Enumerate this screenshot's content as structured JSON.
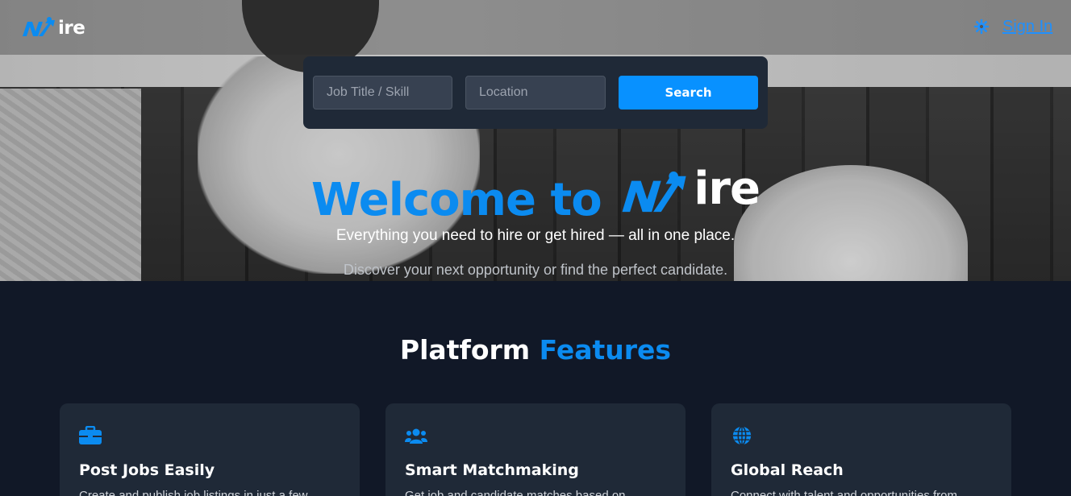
{
  "header": {
    "logo_accent": "NX",
    "logo_rest": "Hire",
    "logo_display_rest": "ire",
    "settings_icon": "gear-icon",
    "signin_label": "Sign In"
  },
  "search": {
    "job_placeholder": "Job Title / Skill",
    "location_placeholder": "Location",
    "button_label": "Search"
  },
  "hero": {
    "welcome_prefix": "Welcome to ",
    "brand_accent": "NX",
    "brand_rest": "ire",
    "tagline": "Everything you need to hire or get hired — all in one place.",
    "subtitle": "Discover your next opportunity or find the perfect candidate."
  },
  "features": {
    "title_main": "Platform ",
    "title_accent": "Features",
    "cards": [
      {
        "icon": "briefcase-icon",
        "title": "Post Jobs Easily",
        "text": "Create and publish job listings in just a few"
      },
      {
        "icon": "users-icon",
        "title": "Smart Matchmaking",
        "text": "Get job and candidate matches based on"
      },
      {
        "icon": "globe-icon",
        "title": "Global Reach",
        "text": "Connect with talent and opportunities from"
      }
    ]
  },
  "colors": {
    "brand": "#0b8bf0",
    "search_bg": "#1f2937",
    "page_bg": "#111827",
    "button": "#0891ff"
  }
}
